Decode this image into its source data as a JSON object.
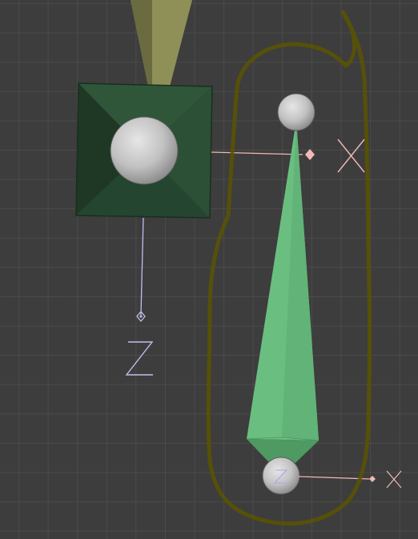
{
  "viewport": {
    "background": "#3d3d3d",
    "grid_color": "#555555"
  },
  "colors": {
    "parent_bone_upper": "#8f8f58",
    "parent_bone_upper_dark": "#6b6b40",
    "bone_box_light": "#2e5437",
    "bone_box_dark": "#1f3a26",
    "bone_box_mid": "#284a30",
    "selected_bone": "#6abf80",
    "selected_bone_shade": "#5aab6f",
    "selected_bone_tip": "#4f9a63",
    "joint_sphere": "#c8c8c8",
    "x_axis": "#f2b8b8",
    "z_axis": "#c0bff0",
    "annotation": "#5a5400"
  },
  "axes": {
    "x_label_large": "X",
    "z_label_large": "Z",
    "x_label_small": "X",
    "z_label_small": "Z"
  },
  "icons": {
    "joint_head": "sphere-joint-icon",
    "joint_tail": "sphere-joint-icon",
    "x_handle": "diamond-handle-icon",
    "z_handle": "diamond-handle-icon"
  }
}
